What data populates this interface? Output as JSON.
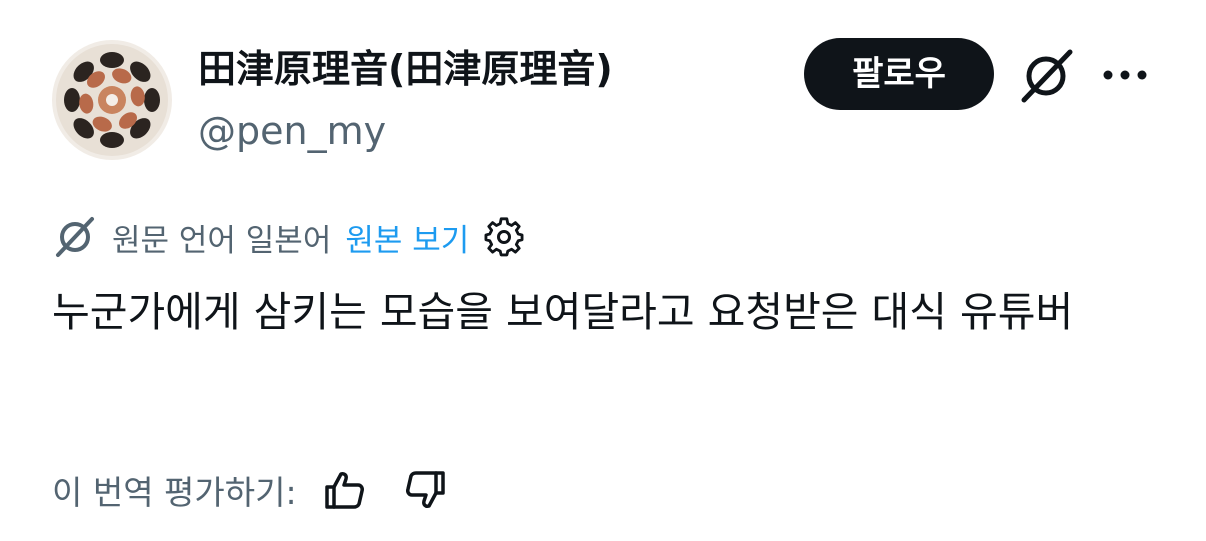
{
  "author": {
    "display_name": "田津原理音(田津原理音)",
    "handle": "@pen_my",
    "avatar_icon": "avatar-image"
  },
  "actions": {
    "follow_label": "팔로우",
    "grok_icon": "grok-icon",
    "more_icon": "more-icon"
  },
  "translation": {
    "source_label": "원문 언어 일본어",
    "view_original_label": "원본 보기",
    "settings_icon": "gear-icon"
  },
  "tweet": {
    "text": "누군가에게 삼키는 모습을 보여달라고 요청받은 대식 유튜버"
  },
  "rating": {
    "label": "이 번역 평가하기:",
    "thumbs_up_icon": "thumbs-up-icon",
    "thumbs_down_icon": "thumbs-down-icon"
  },
  "colors": {
    "text_primary": "#0f1419",
    "text_secondary": "#536471",
    "link": "#1d9bf0",
    "button_bg": "#0f1419",
    "button_text": "#ffffff"
  }
}
